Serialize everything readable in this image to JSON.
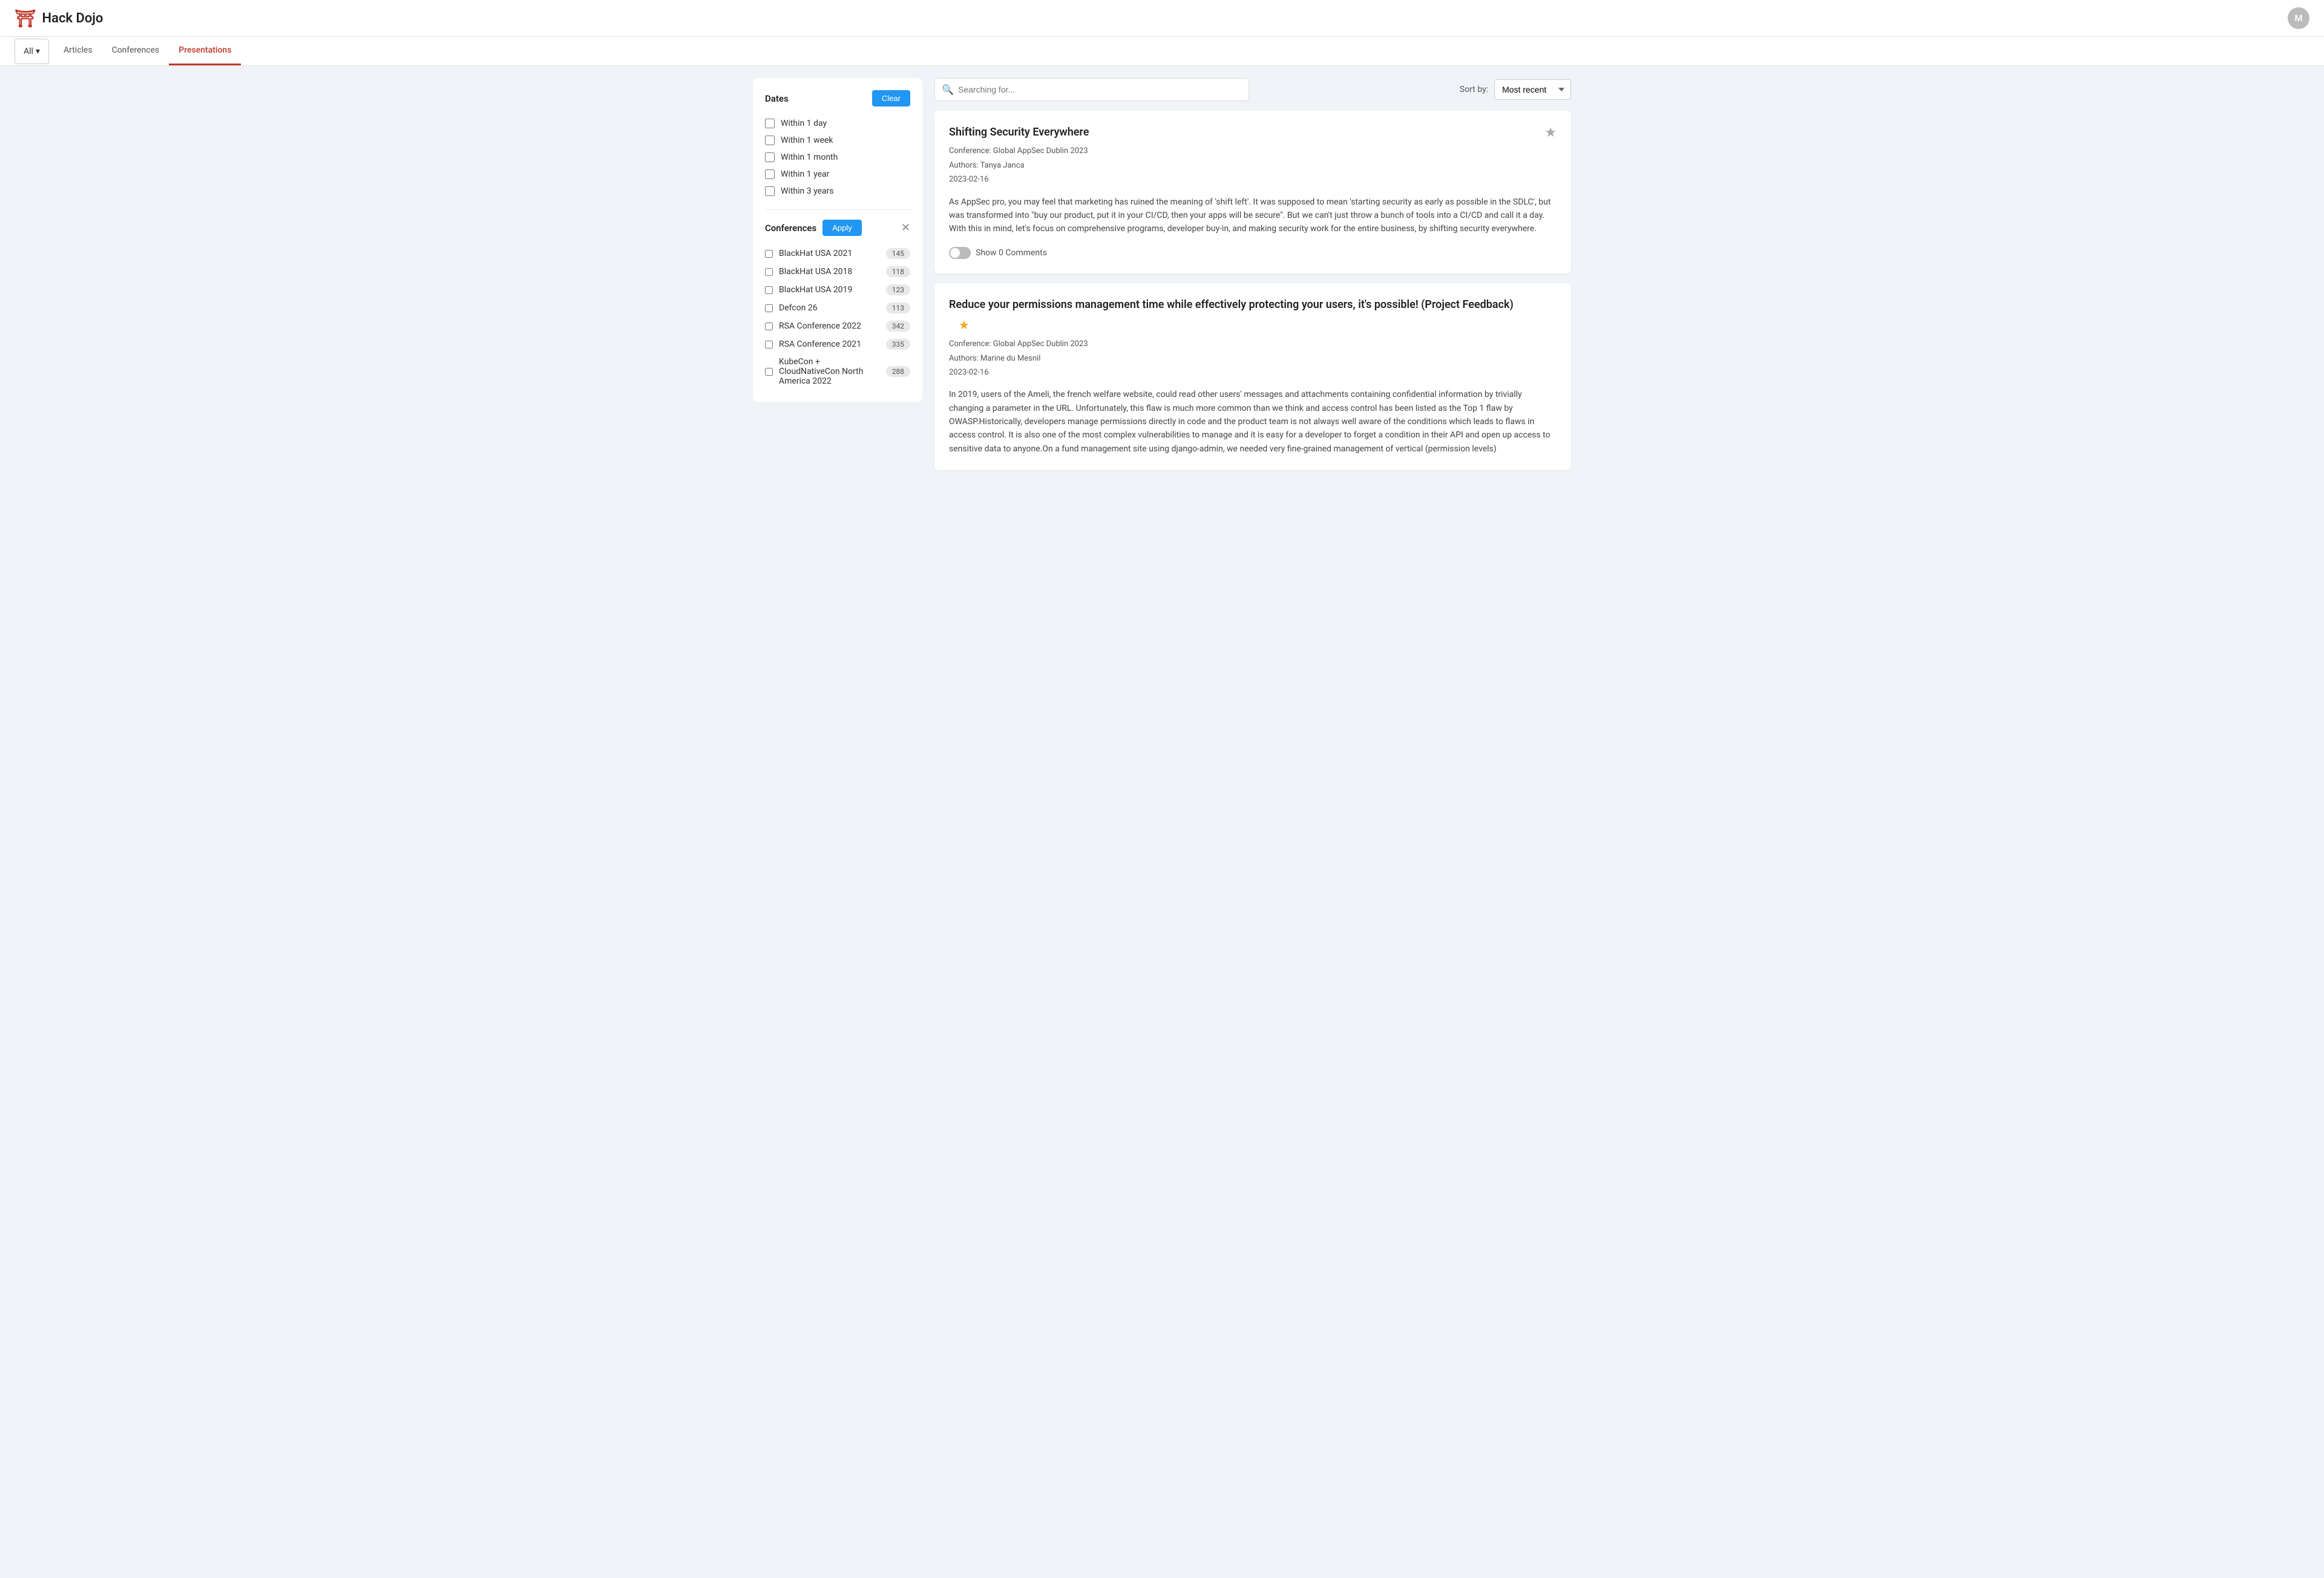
{
  "app": {
    "name": "Hack Dojo",
    "avatar": "M"
  },
  "nav": {
    "dropdown_label": "All",
    "tabs": [
      {
        "label": "Articles",
        "active": false
      },
      {
        "label": "Conferences",
        "active": false
      },
      {
        "label": "Presentations",
        "active": true
      }
    ]
  },
  "sidebar": {
    "dates_title": "Dates",
    "clear_label": "Clear",
    "date_filters": [
      {
        "label": "Within 1 day"
      },
      {
        "label": "Within 1 week"
      },
      {
        "label": "Within 1 month"
      },
      {
        "label": "Within 1 year"
      },
      {
        "label": "Within 3 years"
      }
    ],
    "conferences_title": "Conferences",
    "apply_label": "Apply",
    "conferences": [
      {
        "name": "BlackHat USA 2021",
        "count": "145"
      },
      {
        "name": "BlackHat USA 2018",
        "count": "118"
      },
      {
        "name": "BlackHat USA 2019",
        "count": "123"
      },
      {
        "name": "Defcon 26",
        "count": "113"
      },
      {
        "name": "RSA Conference 2022",
        "count": "342"
      },
      {
        "name": "RSA Conference 2021",
        "count": "335"
      },
      {
        "name": "KubeCon + CloudNativeCon North America 2022",
        "count": "288"
      }
    ]
  },
  "search": {
    "placeholder": "Searching for..."
  },
  "sort": {
    "label": "Sort by:",
    "selected": "Most recent"
  },
  "cards": [
    {
      "title": "Shifting Security Everywhere",
      "starred": false,
      "conference": "Conference:  Global AppSec Dublin 2023",
      "authors": "Authors: Tanya Janca",
      "date": "2023-02-16",
      "body": "As AppSec pro, you may feel that marketing has ruined the meaning of 'shift left'. It was supposed to mean 'starting security as early as possible in the SDLC', but was transformed into \"buy our product, put it in your CI/CD, then your apps will be secure\". But we can't just throw a bunch of tools into a CI/CD and call it a day. With this in mind, let's focus on comprehensive programs, developer buy-in, and making security work for the entire business, by shifting security everywhere.",
      "comments_label": "Show 0 Comments"
    },
    {
      "title": "Reduce your permissions management time while effectively protecting your users, it's possible! (Project Feedback)",
      "starred": true,
      "conference": "Conference:  Global AppSec Dublin 2023",
      "authors": "Authors: Marine du Mesnil",
      "date": "2023-02-16",
      "body": "In 2019, users of the Ameli, the french welfare website, could read other users' messages and attachments containing confidential information by trivially changing a parameter in the URL. Unfortunately, this flaw is much more common than we think and access control has been listed as the Top 1 flaw by OWASP.Historically, developers manage permissions directly in code and the product team is not always well aware of the conditions which leads to flaws in access control. It is also one of the most complex vulnerabilities to manage and it is easy for a developer to forget a condition in their API and open up access to sensitive data to anyone.On a fund management site using django-admin, we needed very fine-grained management of vertical (permission levels)",
      "comments_label": ""
    }
  ]
}
